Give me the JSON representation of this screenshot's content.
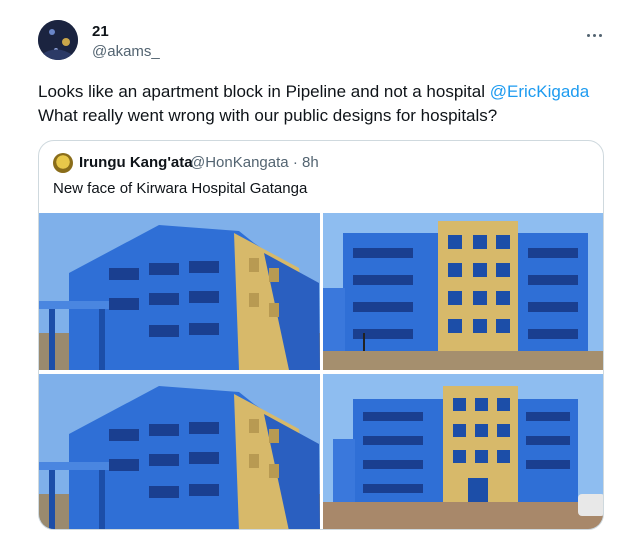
{
  "post": {
    "display_name": "21",
    "handle": "@akams_",
    "text_line1": "Looks like an apartment block in Pipeline and not a hospital ",
    "mention": "@EricKigada",
    "text_line2": "What really went wrong with our public designs for hospitals?",
    "more_icon": "more-horizontal-icon"
  },
  "quote": {
    "display_name": "Irungu Kang'ata",
    "handle": "@HonKangata",
    "separator": "·",
    "time": "8h",
    "text": "New face of Kirwara Hospital Gatanga"
  },
  "colors": {
    "mention": "#1d9bf0",
    "secondary_text": "#536471",
    "border": "#cfd9de",
    "building_blue": "#2f6fd6",
    "building_yellow": "#d7b96a"
  }
}
